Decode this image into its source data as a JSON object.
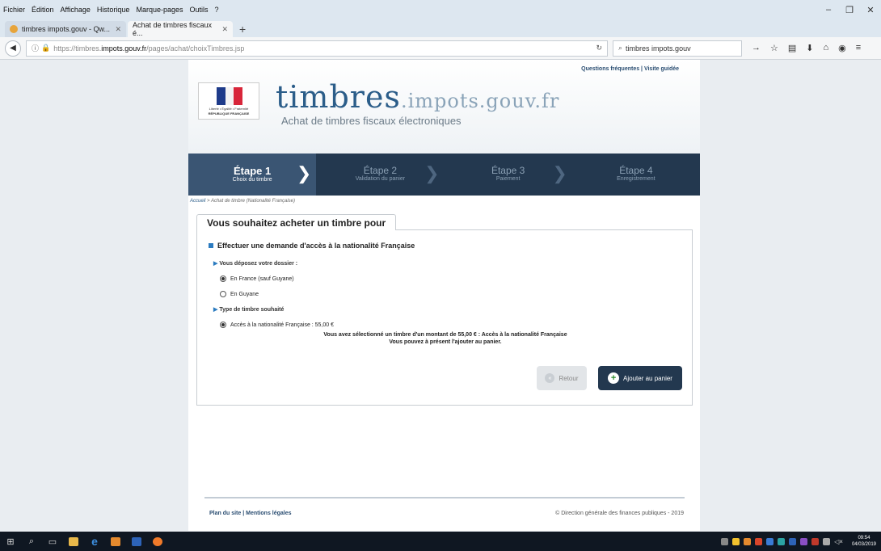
{
  "browser": {
    "menu": [
      "Fichier",
      "Édition",
      "Affichage",
      "Historique",
      "Marque-pages",
      "Outils",
      "?"
    ],
    "tabs": [
      {
        "label": "timbres impots.gouv - Qw..."
      },
      {
        "label": "Achat de timbres fiscaux é..."
      }
    ],
    "url_prefix": "https://timbres.",
    "url_host": "impots.gouv.fr",
    "url_path": "/pages/achat/choixTimbres.jsp",
    "search_value": "timbres impots.gouv"
  },
  "header": {
    "links": "Questions fréquentes | Visite guidée",
    "logo_motto": "Liberté • Égalité • Fraternité",
    "logo_rep": "RÉPUBLIQUE FRANÇAISE",
    "title_main": "timbres",
    "title_rest": ".impots.gouv.fr",
    "subtitle": "Achat de timbres fiscaux électroniques"
  },
  "steps": [
    {
      "num": "Étape 1",
      "label": "Choix du timbre"
    },
    {
      "num": "Étape 2",
      "label": "Validation du panier"
    },
    {
      "num": "Étape 3",
      "label": "Paiement"
    },
    {
      "num": "Étape 4",
      "label": "Enregistrement"
    }
  ],
  "breadcrumb": {
    "home": "Accueil",
    "current": " > Achat de timbre (Nationalité Française)"
  },
  "panel": {
    "tab_title": "Vous souhaitez acheter un timbre pour",
    "section": "Effectuer une demande d'accès à la nationalité Française",
    "q1": "Vous déposez votre dossier :",
    "opt1": "En France (sauf Guyane)",
    "opt2": "En Guyane",
    "q2": "Type de timbre souhaité",
    "opt3": "Accès à la nationalité Française : 55,00 €",
    "note1": "Vous avez sélectionné un timbre d'un montant de 55,00 € : Accès à la nationalité Française",
    "note2": "Vous pouvez à présent l'ajouter au panier.",
    "back_label": "Retour",
    "add_label": "Ajouter au panier"
  },
  "footer": {
    "links": "Plan du site | Mentions légales",
    "copyright": "© Direction générale des finances publiques - 2019"
  },
  "taskbar": {
    "time": "09:54",
    "date": "04/03/2019"
  }
}
